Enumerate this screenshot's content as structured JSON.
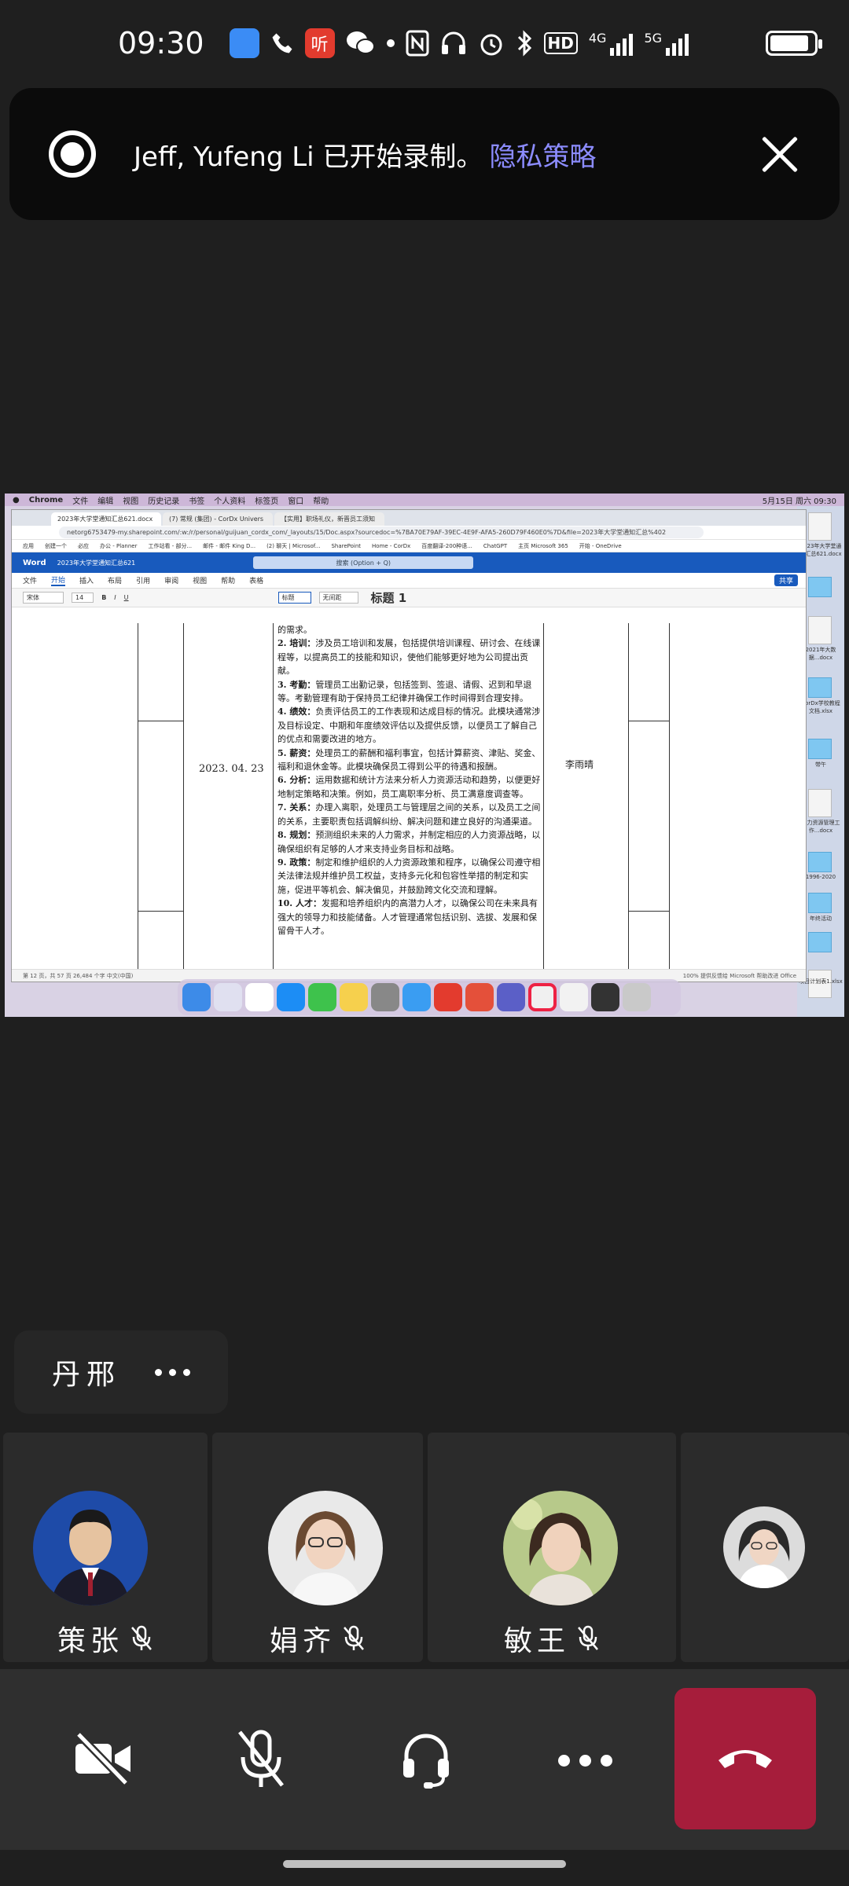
{
  "status_bar": {
    "time": "09:30",
    "hd_label": "HD",
    "net_4g": "4G",
    "net_5g": "5G",
    "icons": [
      "lark-app-icon",
      "phone-icon",
      "netease-music-icon",
      "wechat-icon",
      "dot-icon",
      "nfc-icon",
      "headphones-icon",
      "alarm-icon",
      "bluetooth-icon",
      "hd-icon",
      "signal-4g-icon",
      "signal-5g-icon",
      "battery-icon"
    ]
  },
  "banner": {
    "message": "Jeff, Yufeng Li 已开始录制。",
    "link": "隐私策略"
  },
  "shared_screen": {
    "mac_menu": [
      "Chrome",
      "文件",
      "编辑",
      "视图",
      "历史记录",
      "书签",
      "个人资料",
      "标签页",
      "窗口",
      "帮助"
    ],
    "clock": "5月15日 周六 09:30",
    "tabs": [
      "2023年大学堂通知汇总621.docx",
      "(7) 常规 (集团) - CorDx Univers",
      "【实用】职场礼仪，新晋员工须知"
    ],
    "url": "netorg6753479-my.sharepoint.com/:w:/r/personal/guijuan_cordx_com/_layouts/15/Doc.aspx?sourcedoc=%7BA70E79AF-39EC-4E9F-AFA5-260D79F460E0%7D&file=2023年大学堂通知汇总%402",
    "bookmarks": [
      "应用",
      "创建一个",
      "必应",
      "办公 - Planner",
      "工作站看 - 部分...",
      "邮件 - 邮件 King D...",
      "(2) 聊天 | Microsof...",
      "SharePoint",
      "Home - CorDx",
      "百度翻译-200种语...",
      "ChatGPT",
      "主页 Microsoft 365",
      "开始 - OneDrive"
    ],
    "word": {
      "app": "Word",
      "doc_title": "2023年大学堂通知汇总621",
      "search": "搜索 (Option + Q)",
      "menu": [
        "文件",
        "开始",
        "插入",
        "布局",
        "引用",
        "审阅",
        "视图",
        "帮助",
        "表格"
      ],
      "share": "共享",
      "font_name": "宋体",
      "font_size": "14",
      "style_current": "标题",
      "style_other": "无间距",
      "style_heading": "标题 1"
    },
    "doc": {
      "date": "2023. 04. 23",
      "name": "李雨晴",
      "lines": [
        {
          "b": "",
          "t": "的需求。"
        },
        {
          "b": "2. 培训：",
          "t": "涉及员工培训和发展，包括提供培训课程、研讨会、在线课程等，以提高员工的技能和知识，使他们能够更好地为公司提出贡献。"
        },
        {
          "b": "3. 考勤：",
          "t": "管理员工出勤记录，包括签到、签退、请假、迟到和早退等。考勤管理有助于保持员工纪律并确保工作时间得到合理安排。"
        },
        {
          "b": "4. 绩效：",
          "t": "负责评估员工的工作表现和达成目标的情况。此模块通常涉及目标设定、中期和年度绩效评估以及提供反馈，以便员工了解自己的优点和需要改进的地方。"
        },
        {
          "b": "5. 薪资：",
          "t": "处理员工的薪酬和福利事宜，包括计算薪资、津贴、奖金、福利和退休金等。此模块确保员工得到公平的待遇和报酬。"
        },
        {
          "b": "6. 分析：",
          "t": "运用数据和统计方法来分析人力资源活动和趋势，以便更好地制定策略和决策。例如，员工离职率分析、员工满意度调查等。"
        },
        {
          "b": "7. 关系：",
          "t": "办理入离职，处理员工与管理层之间的关系，以及员工之间的关系，主要职责包括调解纠纷、解决问题和建立良好的沟通渠道。"
        },
        {
          "b": "8. 规划：",
          "t": "预测组织未来的人力需求，并制定相应的人力资源战略，以确保组织有足够的人才来支持业务目标和战略。"
        },
        {
          "b": "9. 政策：",
          "t": "制定和维护组织的人力资源政策和程序，以确保公司遵守相关法律法规并维护员工权益，支持多元化和包容性举措的制定和实施，促进平等机会、解决偏见，并鼓励跨文化交流和理解。"
        },
        {
          "b": "10. 人才：",
          "t": "发掘和培养组织内的高潜力人才，以确保公司在未来具有强大的领导力和技能储备。人才管理通常包括识别、选拔、发展和保留骨干人才。"
        }
      ],
      "status_left": "第 12 页，共 57 页    26,484 个字    中文(中国)",
      "status_right": "100%    提供反馈给 Microsoft    帮助改进 Office"
    },
    "desktop_files": [
      "2023年大学堂通知汇总621.docx",
      "文件在这里",
      "2021年大数据...docx",
      "CorDx学校教程文档.xlsx",
      "带午",
      "人力资源管理工作...docx",
      "1996-2020",
      "年终活动",
      "计划",
      "项目计划表1.xlsx"
    ]
  },
  "active_speaker": {
    "name": "丹邢"
  },
  "participants": [
    {
      "name": "策张",
      "muted": true
    },
    {
      "name": "娟齐",
      "muted": true
    },
    {
      "name": "敏王",
      "muted": true
    },
    {
      "name": "",
      "muted": false
    }
  ],
  "controls": {
    "camera": "camera-off-icon",
    "mic": "mic-off-icon",
    "audio": "headset-icon",
    "more": "more-icon",
    "hangup": "hang-up-icon",
    "hangup_color": "#a61d3b"
  }
}
